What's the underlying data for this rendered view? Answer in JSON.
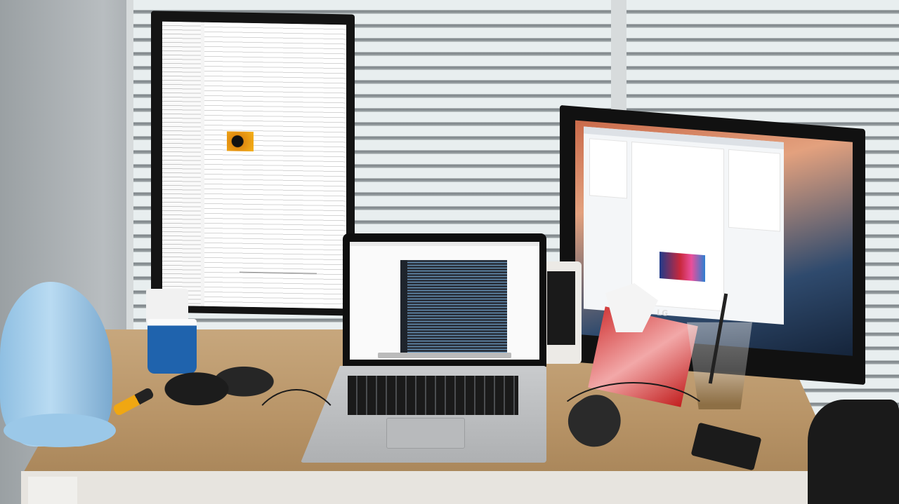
{
  "scene": {
    "description_tags": [
      "desk",
      "vertical-monitor",
      "laptop",
      "widescreen-monitor",
      "kettle",
      "headphones",
      "tissue-box",
      "mouse"
    ],
    "right_monitor": {
      "brand_label": "LG"
    }
  },
  "colors": {
    "desk": "#b89467",
    "kettle": "#9cc7e6",
    "mug": "#1f63ad",
    "tissue_box": "#d23b3b",
    "code_editor": "#2c3440"
  }
}
